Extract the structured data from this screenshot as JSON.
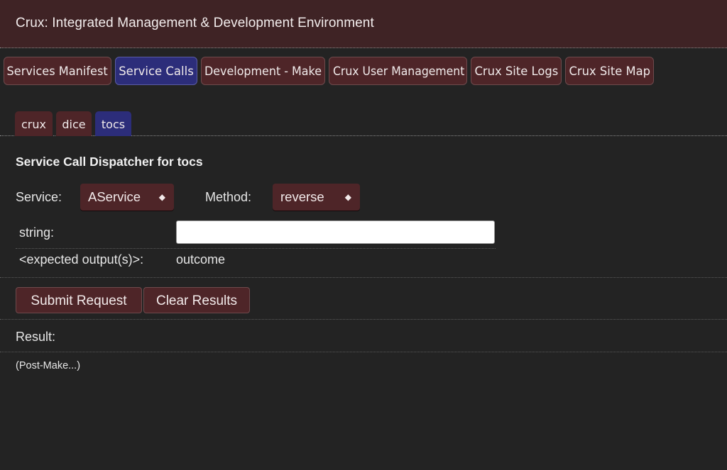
{
  "app": {
    "title": "Crux: Integrated Management & Development Environment"
  },
  "top_tabs": [
    {
      "label": "Services Manifest",
      "active": false
    },
    {
      "label": "Service Calls",
      "active": true
    },
    {
      "label": "Development - Make",
      "active": false
    },
    {
      "label": "Crux User Management",
      "active": false
    },
    {
      "label": "Crux Site Logs",
      "active": false
    },
    {
      "label": "Crux Site Map",
      "active": false
    }
  ],
  "sub_tabs": [
    {
      "label": "crux",
      "active": false
    },
    {
      "label": "dice",
      "active": false
    },
    {
      "label": "tocs",
      "active": true
    }
  ],
  "dispatcher": {
    "heading": "Service Call Dispatcher for tocs",
    "service_label": "Service:",
    "service_value": "AService",
    "method_label": "Method:",
    "method_value": "reverse",
    "select_indicator": "◆",
    "params": [
      {
        "label": "string:",
        "value": "",
        "placeholder": ""
      }
    ],
    "expected_label": "<expected output(s)>:",
    "expected_value": "outcome"
  },
  "actions": {
    "submit_label": "Submit Request",
    "clear_label": "Clear Results"
  },
  "result": {
    "label": "Result:",
    "text": "(Post-Make...)"
  },
  "colors": {
    "background": "#232323",
    "title_bar": "#3f2325",
    "tab_inactive": "#4e2528",
    "tab_active": "#2c2d7a",
    "input": "#ffffff"
  }
}
